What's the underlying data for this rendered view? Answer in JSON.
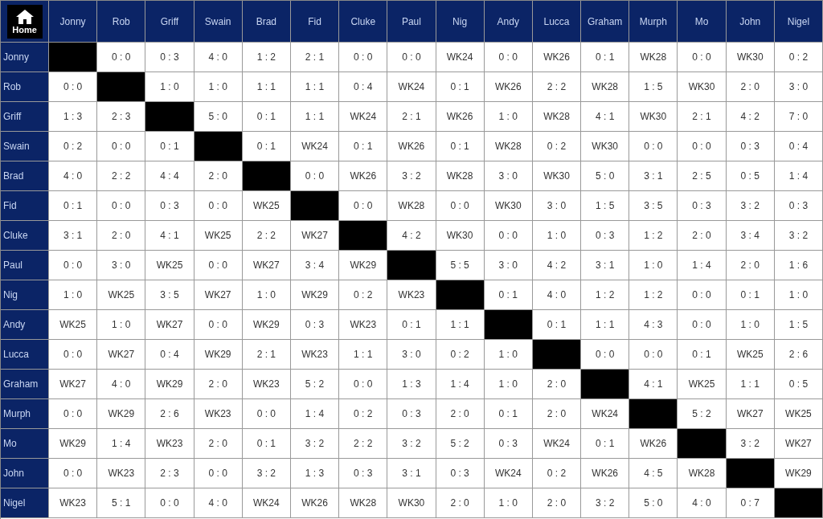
{
  "home_button": {
    "label": "Home"
  },
  "columns": [
    "Jonny",
    "Rob",
    "Griff",
    "Swain",
    "Brad",
    "Fid",
    "Cluke",
    "Paul",
    "Nig",
    "Andy",
    "Lucca",
    "Graham",
    "Murph",
    "Mo",
    "John",
    "Nigel"
  ],
  "rows": [
    {
      "name": "Jonny",
      "cells": [
        null,
        "0 : 0",
        "0 : 3",
        "4 : 0",
        "1 : 2",
        "2 : 1",
        "0 : 0",
        "0 : 0",
        "WK24",
        "0 : 0",
        "WK26",
        "0 : 1",
        "WK28",
        "0 : 0",
        "WK30",
        "0 : 2"
      ]
    },
    {
      "name": "Rob",
      "cells": [
        "0 : 0",
        null,
        "1 : 0",
        "1 : 0",
        "1 : 1",
        "1 : 1",
        "0 : 4",
        "WK24",
        "0 : 1",
        "WK26",
        "2 : 2",
        "WK28",
        "1 : 5",
        "WK30",
        "2 : 0",
        "3 : 0"
      ]
    },
    {
      "name": "Griff",
      "cells": [
        "1 : 3",
        "2 : 3",
        null,
        "5 : 0",
        "0 : 1",
        "1 : 1",
        "WK24",
        "2 : 1",
        "WK26",
        "1 : 0",
        "WK28",
        "4 : 1",
        "WK30",
        "2 : 1",
        "4 : 2",
        "7 : 0"
      ]
    },
    {
      "name": "Swain",
      "cells": [
        "0 : 2",
        "0 : 0",
        "0 : 1",
        null,
        "0 : 1",
        "WK24",
        "0 : 1",
        "WK26",
        "0 : 1",
        "WK28",
        "0 : 2",
        "WK30",
        "0 : 0",
        "0 : 0",
        "0 : 3",
        "0 : 4"
      ]
    },
    {
      "name": "Brad",
      "cells": [
        "4 : 0",
        "2 : 2",
        "4 : 4",
        "2 : 0",
        null,
        "0 : 0",
        "WK26",
        "3 : 2",
        "WK28",
        "3 : 0",
        "WK30",
        "5 : 0",
        "3 : 1",
        "2 : 5",
        "0 : 5",
        "1 : 4"
      ]
    },
    {
      "name": "Fid",
      "cells": [
        "0 : 1",
        "0 : 0",
        "0 : 3",
        "0 : 0",
        "WK25",
        null,
        "0 : 0",
        "WK28",
        "0 : 0",
        "WK30",
        "3 : 0",
        "1 : 5",
        "3 : 5",
        "0 : 3",
        "3 : 2",
        "0 : 3"
      ]
    },
    {
      "name": "Cluke",
      "cells": [
        "3 : 1",
        "2 : 0",
        "4 : 1",
        "WK25",
        "2 : 2",
        "WK27",
        null,
        "4 : 2",
        "WK30",
        "0 : 0",
        "1 : 0",
        "0 : 3",
        "1 : 2",
        "2 : 0",
        "3 : 4",
        "3 : 2"
      ]
    },
    {
      "name": "Paul",
      "cells": [
        "0 : 0",
        "3 : 0",
        "WK25",
        "0 : 0",
        "WK27",
        "3 : 4",
        "WK29",
        null,
        "5 : 5",
        "3 : 0",
        "4 : 2",
        "3 : 1",
        "1 : 0",
        "1 : 4",
        "2 : 0",
        "1 : 6"
      ]
    },
    {
      "name": "Nig",
      "cells": [
        "1 : 0",
        "WK25",
        "3 : 5",
        "WK27",
        "1 : 0",
        "WK29",
        "0 : 2",
        "WK23",
        null,
        "0 : 1",
        "4 : 0",
        "1 : 2",
        "1 : 2",
        "0 : 0",
        "0 : 1",
        "1 : 0"
      ]
    },
    {
      "name": "Andy",
      "cells": [
        "WK25",
        "1 : 0",
        "WK27",
        "0 : 0",
        "WK29",
        "0 : 3",
        "WK23",
        "0 : 1",
        "1 : 1",
        null,
        "0 : 1",
        "1 : 1",
        "4 : 3",
        "0 : 0",
        "1 : 0",
        "1 : 5"
      ]
    },
    {
      "name": "Lucca",
      "cells": [
        "0 : 0",
        "WK27",
        "0 : 4",
        "WK29",
        "2 : 1",
        "WK23",
        "1 : 1",
        "3 : 0",
        "0 : 2",
        "1 : 0",
        null,
        "0 : 0",
        "0 : 0",
        "0 : 1",
        "WK25",
        "2 : 6"
      ]
    },
    {
      "name": "Graham",
      "cells": [
        "WK27",
        "4 : 0",
        "WK29",
        "2 : 0",
        "WK23",
        "5 : 2",
        "0 : 0",
        "1 : 3",
        "1 : 4",
        "1 : 0",
        "2 : 0",
        null,
        "4 : 1",
        "WK25",
        "1 : 1",
        "0 : 5"
      ]
    },
    {
      "name": "Murph",
      "cells": [
        "0 : 0",
        "WK29",
        "2 : 6",
        "WK23",
        "0 : 0",
        "1 : 4",
        "0 : 2",
        "0 : 3",
        "2 : 0",
        "0 : 1",
        "2 : 0",
        "WK24",
        null,
        "5 : 2",
        "WK27",
        "WK25"
      ]
    },
    {
      "name": "Mo",
      "cells": [
        "WK29",
        "1 : 4",
        "WK23",
        "2 : 0",
        "0 : 1",
        "3 : 2",
        "2 : 2",
        "3 : 2",
        "5 : 2",
        "0 : 3",
        "WK24",
        "0 : 1",
        "WK26",
        null,
        "3 : 2",
        "WK27"
      ]
    },
    {
      "name": "John",
      "cells": [
        "0 : 0",
        "WK23",
        "2 : 3",
        "0 : 0",
        "3 : 2",
        "1 : 3",
        "0 : 3",
        "3 : 1",
        "0 : 3",
        "WK24",
        "0 : 2",
        "WK26",
        "4 : 5",
        "WK28",
        null,
        "WK29"
      ]
    },
    {
      "name": "Nigel",
      "cells": [
        "WK23",
        "5 : 1",
        "0 : 0",
        "4 : 0",
        "WK24",
        "WK26",
        "WK28",
        "WK30",
        "2 : 0",
        "1 : 0",
        "2 : 0",
        "3 : 2",
        "5 : 0",
        "4 : 0",
        "0 : 7",
        null
      ]
    }
  ]
}
